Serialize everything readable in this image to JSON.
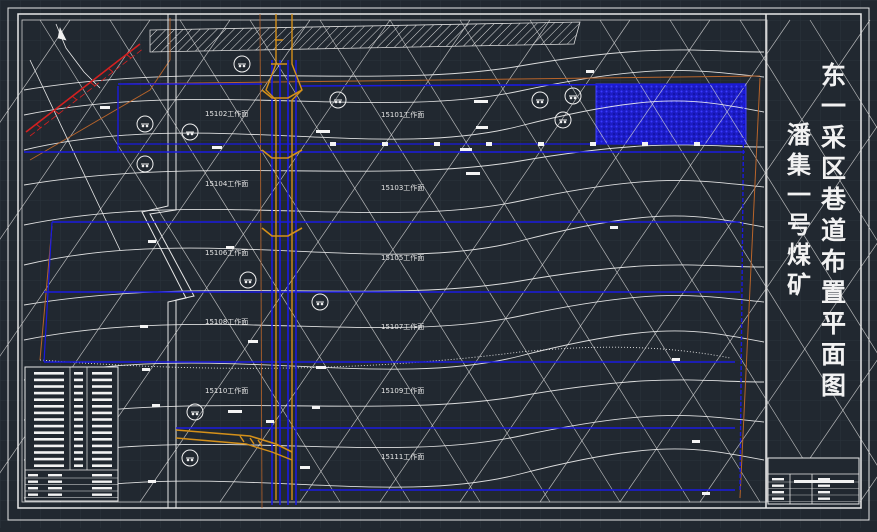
{
  "drawing": {
    "title": "东一采区巷道布置平面图",
    "mine_name": "潘集一号煤矿"
  },
  "panels": [
    {
      "id": "panel-1",
      "label": "15102工作面"
    },
    {
      "id": "panel-2",
      "label": "15104工作面"
    },
    {
      "id": "panel-3",
      "label": "15106工作面"
    },
    {
      "id": "panel-4",
      "label": "15108工作面"
    },
    {
      "id": "panel-5",
      "label": "15110工作面"
    },
    {
      "id": "panel-6",
      "label": "15101工作面"
    },
    {
      "id": "panel-7",
      "label": "15103工作面"
    },
    {
      "id": "panel-8",
      "label": "15105工作面"
    },
    {
      "id": "panel-9",
      "label": "15107工作面"
    },
    {
      "id": "panel-10",
      "label": "15109工作面"
    },
    {
      "id": "panel-11",
      "label": "15111工作面"
    }
  ],
  "colors": {
    "background": "#212830",
    "grid": "#2b333c",
    "frame": "#e8e8e8",
    "roadway": "#1a1adf",
    "shaft": "#d4901a",
    "fault": "#d42020",
    "contour": "#f2f2f2",
    "boundary": "#b8642a"
  }
}
